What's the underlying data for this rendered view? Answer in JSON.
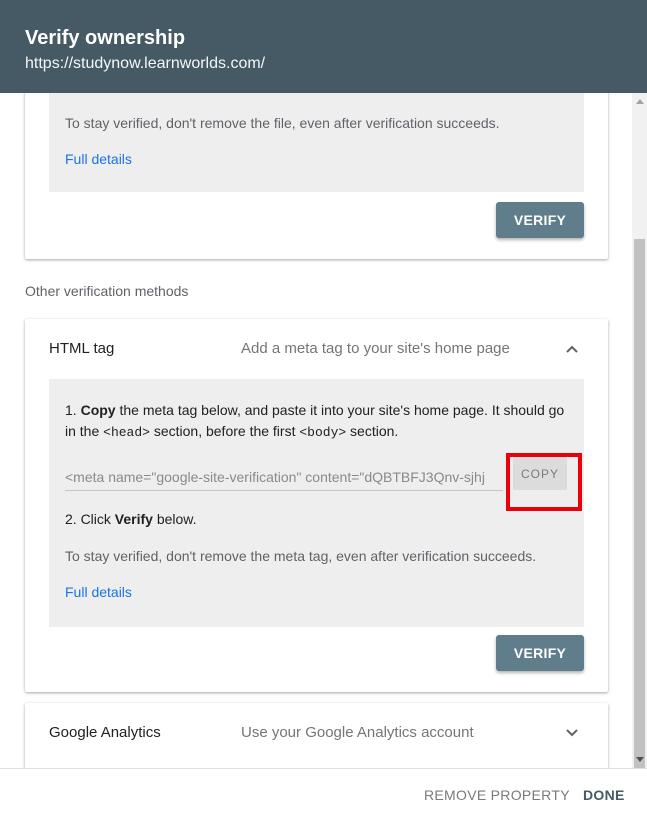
{
  "header": {
    "title": "Verify ownership",
    "subtitle": "https://studynow.learnworlds.com/"
  },
  "file_method": {
    "note": "To stay verified, don't remove the file, even after verification succeeds.",
    "full_details": "Full details",
    "verify_label": "VERIFY"
  },
  "other_methods_label": "Other verification methods",
  "html_tag": {
    "title": "HTML tag",
    "description": "Add a meta tag to your site's home page",
    "step1": {
      "prefix": "1. ",
      "bold": "Copy",
      "text_a": " the meta tag below, and paste it into your site's home page. It should go in the ",
      "code_head": "<head>",
      "text_b": " section, before the first ",
      "code_body": "<body>",
      "text_c": " section."
    },
    "meta_tag": "<meta name=\"google-site-verification\" content=\"dQBTBFJ3Qnv-sjhj",
    "copy_label": "COPY",
    "step2": {
      "prefix": "2. Click ",
      "bold": "Verify",
      "suffix": " below."
    },
    "note": "To stay verified, don't remove the meta tag, even after verification succeeds.",
    "full_details": "Full details",
    "verify_label": "VERIFY"
  },
  "google_analytics": {
    "title": "Google Analytics",
    "description": "Use your Google Analytics account"
  },
  "footer": {
    "remove_label": "REMOVE PROPERTY",
    "done_label": "DONE"
  },
  "colors": {
    "header_bg": "#455a64",
    "verify_bg": "#607d8b",
    "link": "#1a73e8",
    "highlight": "#e8000b"
  },
  "icons": {
    "html_tag_toggle": "chevron-up-icon",
    "analytics_toggle": "chevron-down-icon"
  }
}
